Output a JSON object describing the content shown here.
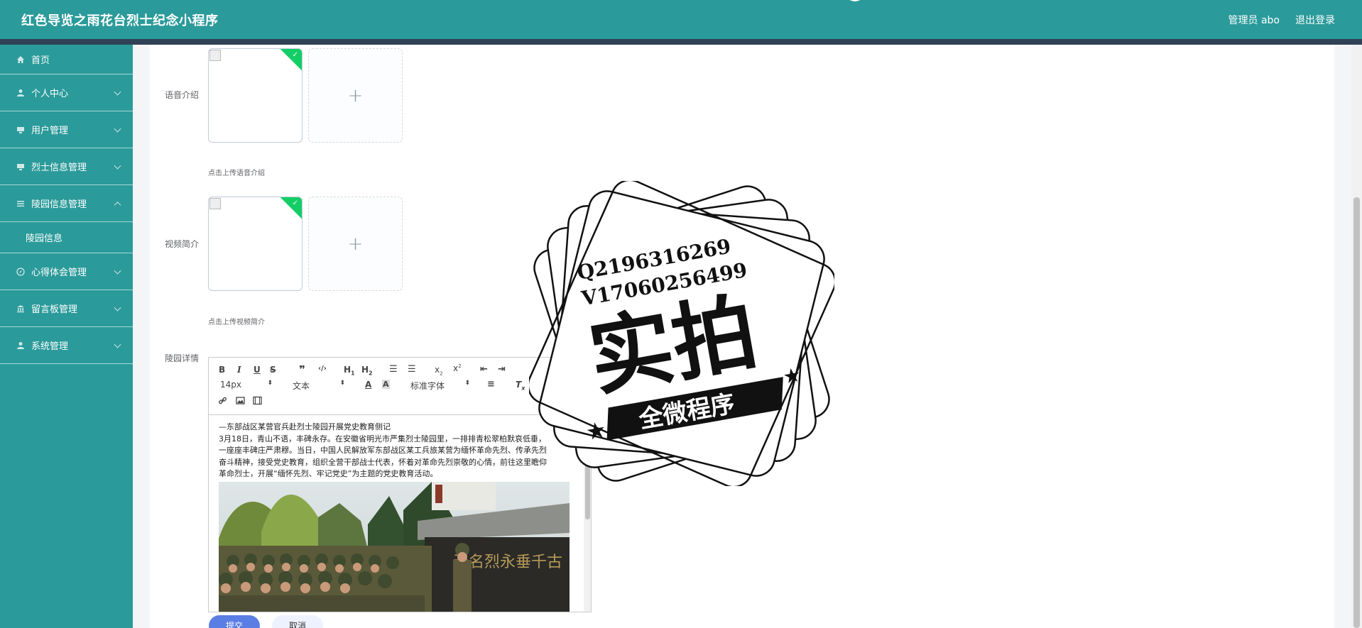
{
  "header": {
    "title": "红色导览之雨花台烈士纪念小程序",
    "user": "管理员 abo",
    "logout": "退出登录"
  },
  "sidebar": {
    "items": [
      {
        "label": "首页",
        "icon": "home-icon"
      },
      {
        "label": "个人中心",
        "icon": "user-icon"
      },
      {
        "label": "用户管理",
        "icon": "monitor-icon"
      },
      {
        "label": "烈士信息管理",
        "icon": "monitor-icon"
      },
      {
        "label": "陵园信息管理",
        "icon": "list-icon"
      },
      {
        "label": "心得体会管理",
        "icon": "compass-icon"
      },
      {
        "label": "留言板管理",
        "icon": "bank-icon"
      },
      {
        "label": "系统管理",
        "icon": "user-icon"
      }
    ],
    "submenu": {
      "label": "陵园信息"
    }
  },
  "form": {
    "audio_label": "语音介绍",
    "audio_hint": "点击上传语音介绍",
    "video_label": "视频简介",
    "video_hint": "点击上传视频简介",
    "detail_label": "陵园详情"
  },
  "editor": {
    "size_select": "14px",
    "text_select": "文本",
    "font_select": "标准字体",
    "content_lines": [
      "—东部战区某营官兵赴烈士陵园开展党史教育侧记",
      "3月18日，青山不语，丰碑永存。在安徽省明光市严集烈士陵园里，一排排青松翠柏默哀低垂，",
      "一座座丰碑庄严肃穆。当日，中国人民解放军东部战区某工兵旅某营为缅怀革命先烈、传承先烈",
      "奋斗精神，接受党史教育，组织全营干部战士代表，怀着对革命先烈崇敬的心情，前往这里瞻仰",
      "革命烈士，开展“缅怀先烈、牢记党史”为主题的党史教育活动。"
    ]
  },
  "buttons": {
    "submit": "提交",
    "cancel": "取消"
  },
  "watermark": {
    "qq": "Q2196316269",
    "vx": "V17060256499",
    "main": "实拍",
    "banner": "全微程序"
  }
}
